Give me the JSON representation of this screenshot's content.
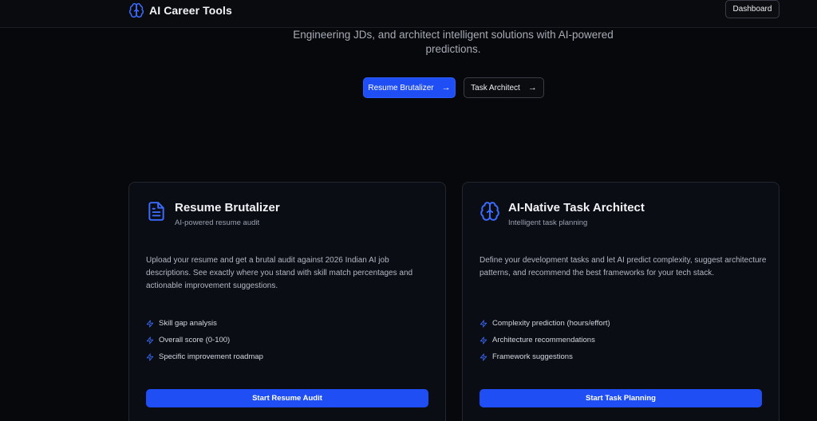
{
  "header": {
    "brand_name": "AI Career Tools",
    "brand_icon": "brain-icon",
    "dashboard_label": "Dashboard"
  },
  "hero": {
    "description_line1": "Engineering JDs, and architect intelligent solutions with AI-powered",
    "description_line2": "predictions.",
    "primary_cta": "Resume Brutalizer",
    "secondary_cta": "Task Architect",
    "cta_arrow": "→"
  },
  "cards": [
    {
      "icon": "document-icon",
      "title": "Resume Brutalizer",
      "subtitle": "AI-powered resume audit",
      "description": "Upload your resume and get a brutal audit against 2026 Indian AI job descriptions. See exactly where you stand with skill match percentages and actionable improvement suggestions.",
      "features": [
        "Skill gap analysis",
        "Overall score (0-100)",
        "Specific improvement roadmap"
      ],
      "button": "Start Resume Audit"
    },
    {
      "icon": "brain-icon",
      "title": "AI-Native Task Architect",
      "subtitle": "Intelligent task planning",
      "description": "Define your development tasks and let AI predict complexity, suggest architecture patterns, and recommend the best frameworks for your tech stack.",
      "features": [
        "Complexity prediction (hours/effort)",
        "Architecture recommendations",
        "Framework suggestions"
      ],
      "button": "Start Task Planning"
    }
  ],
  "colors": {
    "accent": "#1f4ef5",
    "background": "#07080b",
    "card_background": "#0b0d15"
  }
}
